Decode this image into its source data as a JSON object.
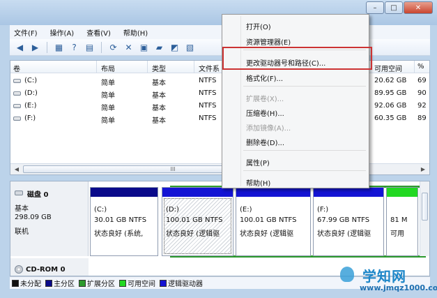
{
  "window": {
    "controls": {
      "minimize": "–",
      "maximize": "□",
      "close": "✕"
    }
  },
  "menubar": [
    "文件(F)",
    "操作(A)",
    "查看(V)",
    "帮助(H)"
  ],
  "toolbar": {
    "icons": [
      "back-arrow-icon",
      "forward-arrow-icon",
      "console-tree-icon",
      "help-icon",
      "properties-icon",
      "refresh-icon",
      "delete-icon",
      "new-icon",
      "open-folder-icon",
      "check-icon",
      "rescan-icon"
    ]
  },
  "volume_list": {
    "columns": [
      "卷",
      "布局",
      "类型",
      "文件系",
      "可用空间",
      "%"
    ],
    "rows": [
      {
        "vol": "(C:)",
        "layout": "简单",
        "type": "基本",
        "fs": "NTFS",
        "free": "20.62 GB",
        "pct": "69"
      },
      {
        "vol": "(D:)",
        "layout": "简单",
        "type": "基本",
        "fs": "NTFS",
        "free": "89.95 GB",
        "pct": "90"
      },
      {
        "vol": "(E:)",
        "layout": "简单",
        "type": "基本",
        "fs": "NTFS",
        "free": "92.06 GB",
        "pct": "92"
      },
      {
        "vol": "(F:)",
        "layout": "简单",
        "type": "基本",
        "fs": "NTFS",
        "free": "60.35 GB",
        "pct": "89"
      }
    ],
    "scroll_label": "III"
  },
  "disk0": {
    "name": "磁盘 0",
    "type": "基本",
    "size": "298.09 GB",
    "status": "联机",
    "partitions": [
      {
        "label": "(C:)",
        "size": "30.01 GB NTFS",
        "status": "状态良好 (系统,",
        "bar_color": "#0a0a8a",
        "selected": false
      },
      {
        "label": "(D:)",
        "size": "100.01 GB NTFS",
        "status": "状态良好 (逻辑驱",
        "bar_color": "#1414d4",
        "selected": true
      },
      {
        "label": "(E:)",
        "size": "100.01 GB NTFS",
        "status": "状态良好 (逻辑驱",
        "bar_color": "#1414d4",
        "selected": false
      },
      {
        "label": "(F:)",
        "size": "67.99 GB NTFS",
        "status": "状态良好 (逻辑驱",
        "bar_color": "#1414d4",
        "selected": false
      },
      {
        "label": "",
        "size": "81 M",
        "status": "可用",
        "bar_color": "#22d822",
        "selected": false
      }
    ]
  },
  "cdrom": {
    "name": "CD-ROM 0"
  },
  "legend": [
    {
      "label": "未分配",
      "color": "#111111"
    },
    {
      "label": "主分区",
      "color": "#0a0a8a"
    },
    {
      "label": "扩展分区",
      "color": "#2d9a2d"
    },
    {
      "label": "可用空间",
      "color": "#22d822"
    },
    {
      "label": "逻辑驱动器",
      "color": "#1414d4"
    }
  ],
  "context_menu": {
    "items": [
      {
        "label": "打开(O)",
        "enabled": true
      },
      {
        "label": "资源管理器(E)",
        "enabled": true
      },
      {
        "label": "更改驱动器号和路径(C)...",
        "enabled": true,
        "highlighted": true
      },
      {
        "label": "格式化(F)...",
        "enabled": true
      },
      {
        "label": "扩展卷(X)...",
        "enabled": false
      },
      {
        "label": "压缩卷(H)...",
        "enabled": true
      },
      {
        "label": "添加镜像(A)...",
        "enabled": false
      },
      {
        "label": "删除卷(D)...",
        "enabled": true
      },
      {
        "label": "属性(P)",
        "enabled": true
      },
      {
        "label": "帮助(H)",
        "enabled": true
      }
    ]
  },
  "watermark": {
    "title": "学知网",
    "url": "www.jmqz1000.com"
  },
  "colors": {
    "highlight_border": "#cc3333",
    "extended_outline": "#2d9a2d"
  }
}
